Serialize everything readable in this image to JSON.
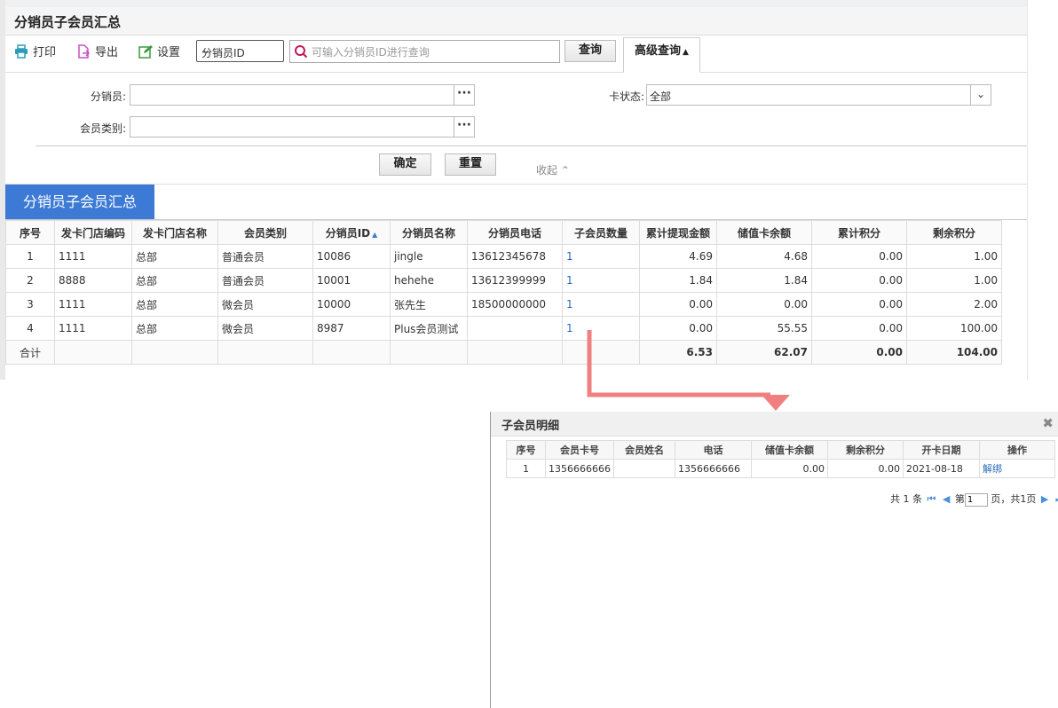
{
  "page": {
    "title": "分销员子会员汇总"
  },
  "toolbar": {
    "print_label": "打印",
    "export_label": "导出",
    "settings_label": "设置",
    "field_select_value": "分销员ID",
    "search_placeholder": "可输入分销员ID进行查询",
    "query_label": "查询",
    "advanced_label": "高级查询"
  },
  "filters": {
    "distributor_label": "分销员:",
    "member_type_label": "会员类别:",
    "card_status_label": "卡状态:",
    "card_status_value": "全部",
    "confirm_label": "确定",
    "reset_label": "重置",
    "collapse_label": "收起"
  },
  "section": {
    "tab_label": "分销员子会员汇总"
  },
  "grid": {
    "columns": [
      "序号",
      "发卡门店编码",
      "发卡门店名称",
      "会员类别",
      "分销员ID",
      "分销员名称",
      "分销员电话",
      "子会员数量",
      "累计提现金额",
      "储值卡余额",
      "累计积分",
      "剩余积分"
    ],
    "rows": [
      {
        "no": "1",
        "store_code": "1111",
        "store_name": "总部",
        "member_type": "普通会员",
        "dist_id": "10086",
        "dist_name": "jingle",
        "phone": "13612345678",
        "sub_count": "1",
        "withdraw": "4.69",
        "balance": "4.68",
        "points": "0.00",
        "remain": "1.00"
      },
      {
        "no": "2",
        "store_code": "8888",
        "store_name": "总部",
        "member_type": "普通会员",
        "dist_id": "10001",
        "dist_name": "hehehe",
        "phone": "13612399999",
        "sub_count": "1",
        "withdraw": "1.84",
        "balance": "1.84",
        "points": "0.00",
        "remain": "1.00"
      },
      {
        "no": "3",
        "store_code": "1111",
        "store_name": "总部",
        "member_type": "微会员",
        "dist_id": "10000",
        "dist_name": "张先生",
        "phone": "18500000000",
        "sub_count": "1",
        "withdraw": "0.00",
        "balance": "0.00",
        "points": "0.00",
        "remain": "2.00"
      },
      {
        "no": "4",
        "store_code": "1111",
        "store_name": "总部",
        "member_type": "微会员",
        "dist_id": "8987",
        "dist_name": "Plus会员测试",
        "phone": "",
        "sub_count": "1",
        "withdraw": "0.00",
        "balance": "55.55",
        "points": "0.00",
        "remain": "100.00"
      }
    ],
    "total": {
      "label": "合计",
      "withdraw": "6.53",
      "balance": "62.07",
      "points": "0.00",
      "remain": "104.00"
    }
  },
  "modal": {
    "title": "子会员明细",
    "columns": [
      "序号",
      "会员卡号",
      "会员姓名",
      "电话",
      "储值卡余额",
      "剩余积分",
      "开卡日期",
      "操作"
    ],
    "rows": [
      {
        "no": "1",
        "card": "1356666666",
        "name": "",
        "phone": "1356666666",
        "balance": "0.00",
        "remain": "0.00",
        "date": "2021-08-18",
        "action": "解绑"
      }
    ],
    "pager": {
      "total_text": "共 1 条",
      "page_prefix": "第",
      "page_value": "1",
      "page_suffix": "页，共1页"
    }
  },
  "colors": {
    "accent": "#3c7ad6",
    "link": "#2a6ab9",
    "arrow": "#f08080"
  }
}
